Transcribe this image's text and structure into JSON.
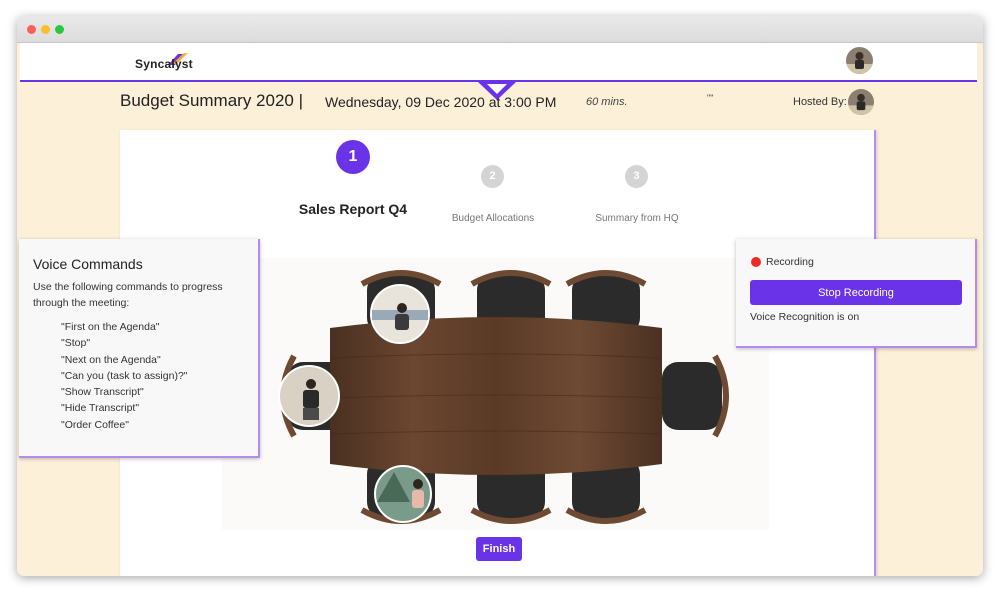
{
  "app": {
    "logo_text": "Syncalyst",
    "accent_color": "#6a33e8"
  },
  "meeting": {
    "title": "Budget Summary 2020 |",
    "date": "Wednesday, 09 Dec 2020 at 3:00 PM",
    "duration": "60 mins.",
    "quote": "\"\"",
    "hosted_by_label": "Hosted By:"
  },
  "agenda": {
    "steps": [
      {
        "number": "1",
        "label": "Sales Report Q4",
        "state": "active"
      },
      {
        "number": "2",
        "label": "Budget Allocations",
        "state": "inactive"
      },
      {
        "number": "3",
        "label": "Summary from HQ",
        "state": "inactive"
      }
    ]
  },
  "voice_commands": {
    "title": "Voice Commands",
    "intro": "Use the following commands to progress through the meeting:",
    "commands": [
      "\"First on the Agenda\"",
      "\"Stop\"",
      "\"Next on the Agenda\"",
      "\"Can you (task to assign)?\"",
      "\"Show Transcript\"",
      "\"Hide Transcript\"",
      "\"Order Coffee\""
    ]
  },
  "recording": {
    "status_label": "Recording",
    "stop_button_label": "Stop Recording",
    "voice_status": "Voice Recognition is on"
  },
  "finish_button_label": "Finish",
  "icons": {
    "collapse": "chevron-down-icon",
    "recording": "record-dot-icon"
  }
}
